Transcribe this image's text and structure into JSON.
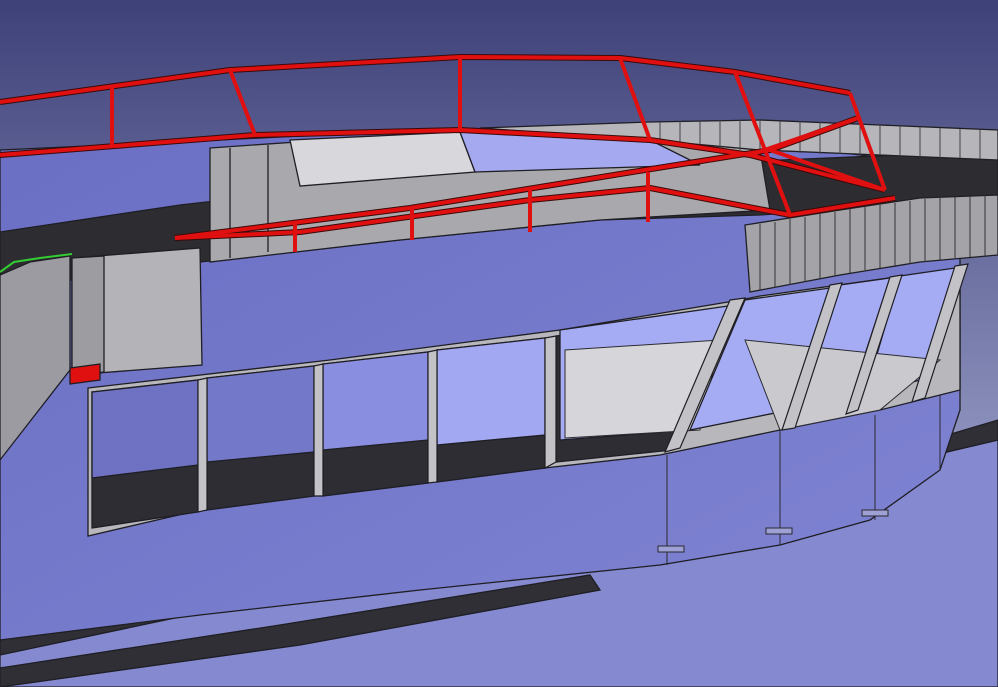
{
  "viewer": {
    "background_top": "#3d4178",
    "background_bottom": "#b9bde2"
  },
  "model": {
    "selection_color": "#e01010",
    "preselection_color": "#33cc33",
    "hull_color": "#7b7fd0",
    "glass_color": "#a0a6ee",
    "deck_color": "#2e2e32",
    "structure_color": "#b8b8bc",
    "edge_color": "#1e1e24"
  }
}
